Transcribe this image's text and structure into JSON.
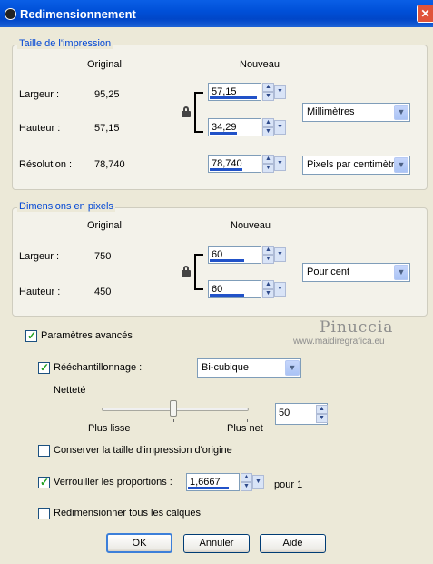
{
  "window": {
    "title": "Redimensionnement",
    "close_label": "✕"
  },
  "print_size": {
    "legend": "Taille de l'impression",
    "col_original": "Original",
    "col_new": "Nouveau",
    "width_label": "Largeur :",
    "width_original": "95,25",
    "width_new": "57,15",
    "height_label": "Hauteur :",
    "height_original": "57,15",
    "height_new": "34,29",
    "resolution_label": "Résolution :",
    "resolution_original": "78,740",
    "resolution_new": "78,740",
    "unit_value": "Millimètres",
    "resolution_unit_value": "Pixels par centimètre"
  },
  "pixel_dims": {
    "legend": "Dimensions en pixels",
    "col_original": "Original",
    "col_new": "Nouveau",
    "width_label": "Largeur :",
    "width_original": "750",
    "width_new": "60",
    "height_label": "Hauteur :",
    "height_original": "450",
    "height_new": "60",
    "unit_value": "Pour cent"
  },
  "watermark": {
    "name": "Pinuccia",
    "url": "www.maidiregrafica.eu"
  },
  "advanced": {
    "label": "Paramètres avancés",
    "checked": true,
    "resample_label": "Rééchantillonnage :",
    "resample_checked": true,
    "resample_value": "Bi-cubique",
    "sharpness_label": "Netteté",
    "sharpness_value": "50",
    "sharpness_fraction": 0.5,
    "slider_left_label": "Plus lisse",
    "slider_right_label": "Plus net",
    "keep_print_size_label": "Conserver la taille d'impression d'origine",
    "keep_print_size_checked": false,
    "lock_ratio_label": "Verrouiller les proportions :",
    "lock_ratio_checked": true,
    "ratio_value": "1,6667",
    "ratio_suffix": "pour 1",
    "resize_all_layers_label": "Redimensionner tous les calques",
    "resize_all_layers_checked": false
  },
  "buttons": {
    "ok": "OK",
    "cancel": "Annuler",
    "help": "Aide"
  },
  "colors": {
    "titlebar": "#0050d8",
    "legend_text": "#0046d5",
    "progress_bar": "#2152c8",
    "checkmark": "#21a121"
  }
}
